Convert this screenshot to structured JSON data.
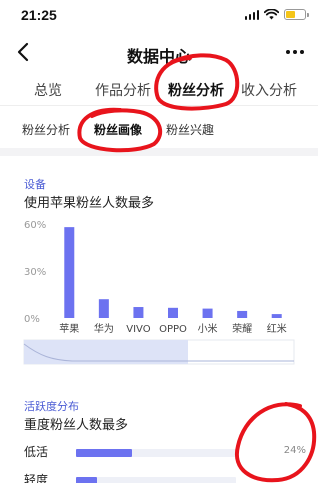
{
  "status_bar": {
    "time": "21:25",
    "icons": [
      "signal-icon",
      "wifi-icon",
      "battery-icon"
    ],
    "battery_color": "#f5c518"
  },
  "nav": {
    "title": "数据中心",
    "back_icon": "chevron-left-icon",
    "more_icon": "more-horizontal-icon"
  },
  "tabs": [
    {
      "label": "总览",
      "active": false
    },
    {
      "label": "作品分析",
      "active": false
    },
    {
      "label": "粉丝分析",
      "active": true
    },
    {
      "label": "收入分析",
      "active": false
    }
  ],
  "subtabs": [
    {
      "label": "粉丝分析",
      "active": false
    },
    {
      "label": "粉丝画像",
      "active": true
    },
    {
      "label": "粉丝兴趣",
      "active": false
    }
  ],
  "device_section": {
    "label": "设备",
    "title": "使用苹果粉丝人数最多"
  },
  "activity_section": {
    "label": "活跃度分布",
    "title": "重度粉丝人数最多",
    "rows": [
      {
        "label": "低活",
        "value": 0.24,
        "value_text": "24%"
      },
      {
        "label": "轻度",
        "value": 0.09,
        "value_text": ""
      }
    ]
  },
  "colors": {
    "accent": "#6c72f0",
    "section_label": "#4a5bd4",
    "annotation_red": "#e8141c"
  },
  "chart_data": {
    "type": "bar",
    "categories": [
      "苹果",
      "华为",
      "VIVO",
      "OPPO",
      "小米",
      "荣耀",
      "红米"
    ],
    "values": [
      58,
      12,
      7,
      6.5,
      6,
      4.5,
      2.5
    ],
    "yticks": [
      "60%",
      "30%",
      "0%"
    ],
    "ylim": [
      0,
      60
    ],
    "grid": false,
    "title": "",
    "xlabel": "",
    "ylabel": "",
    "bar_color": "#6c72f0"
  }
}
